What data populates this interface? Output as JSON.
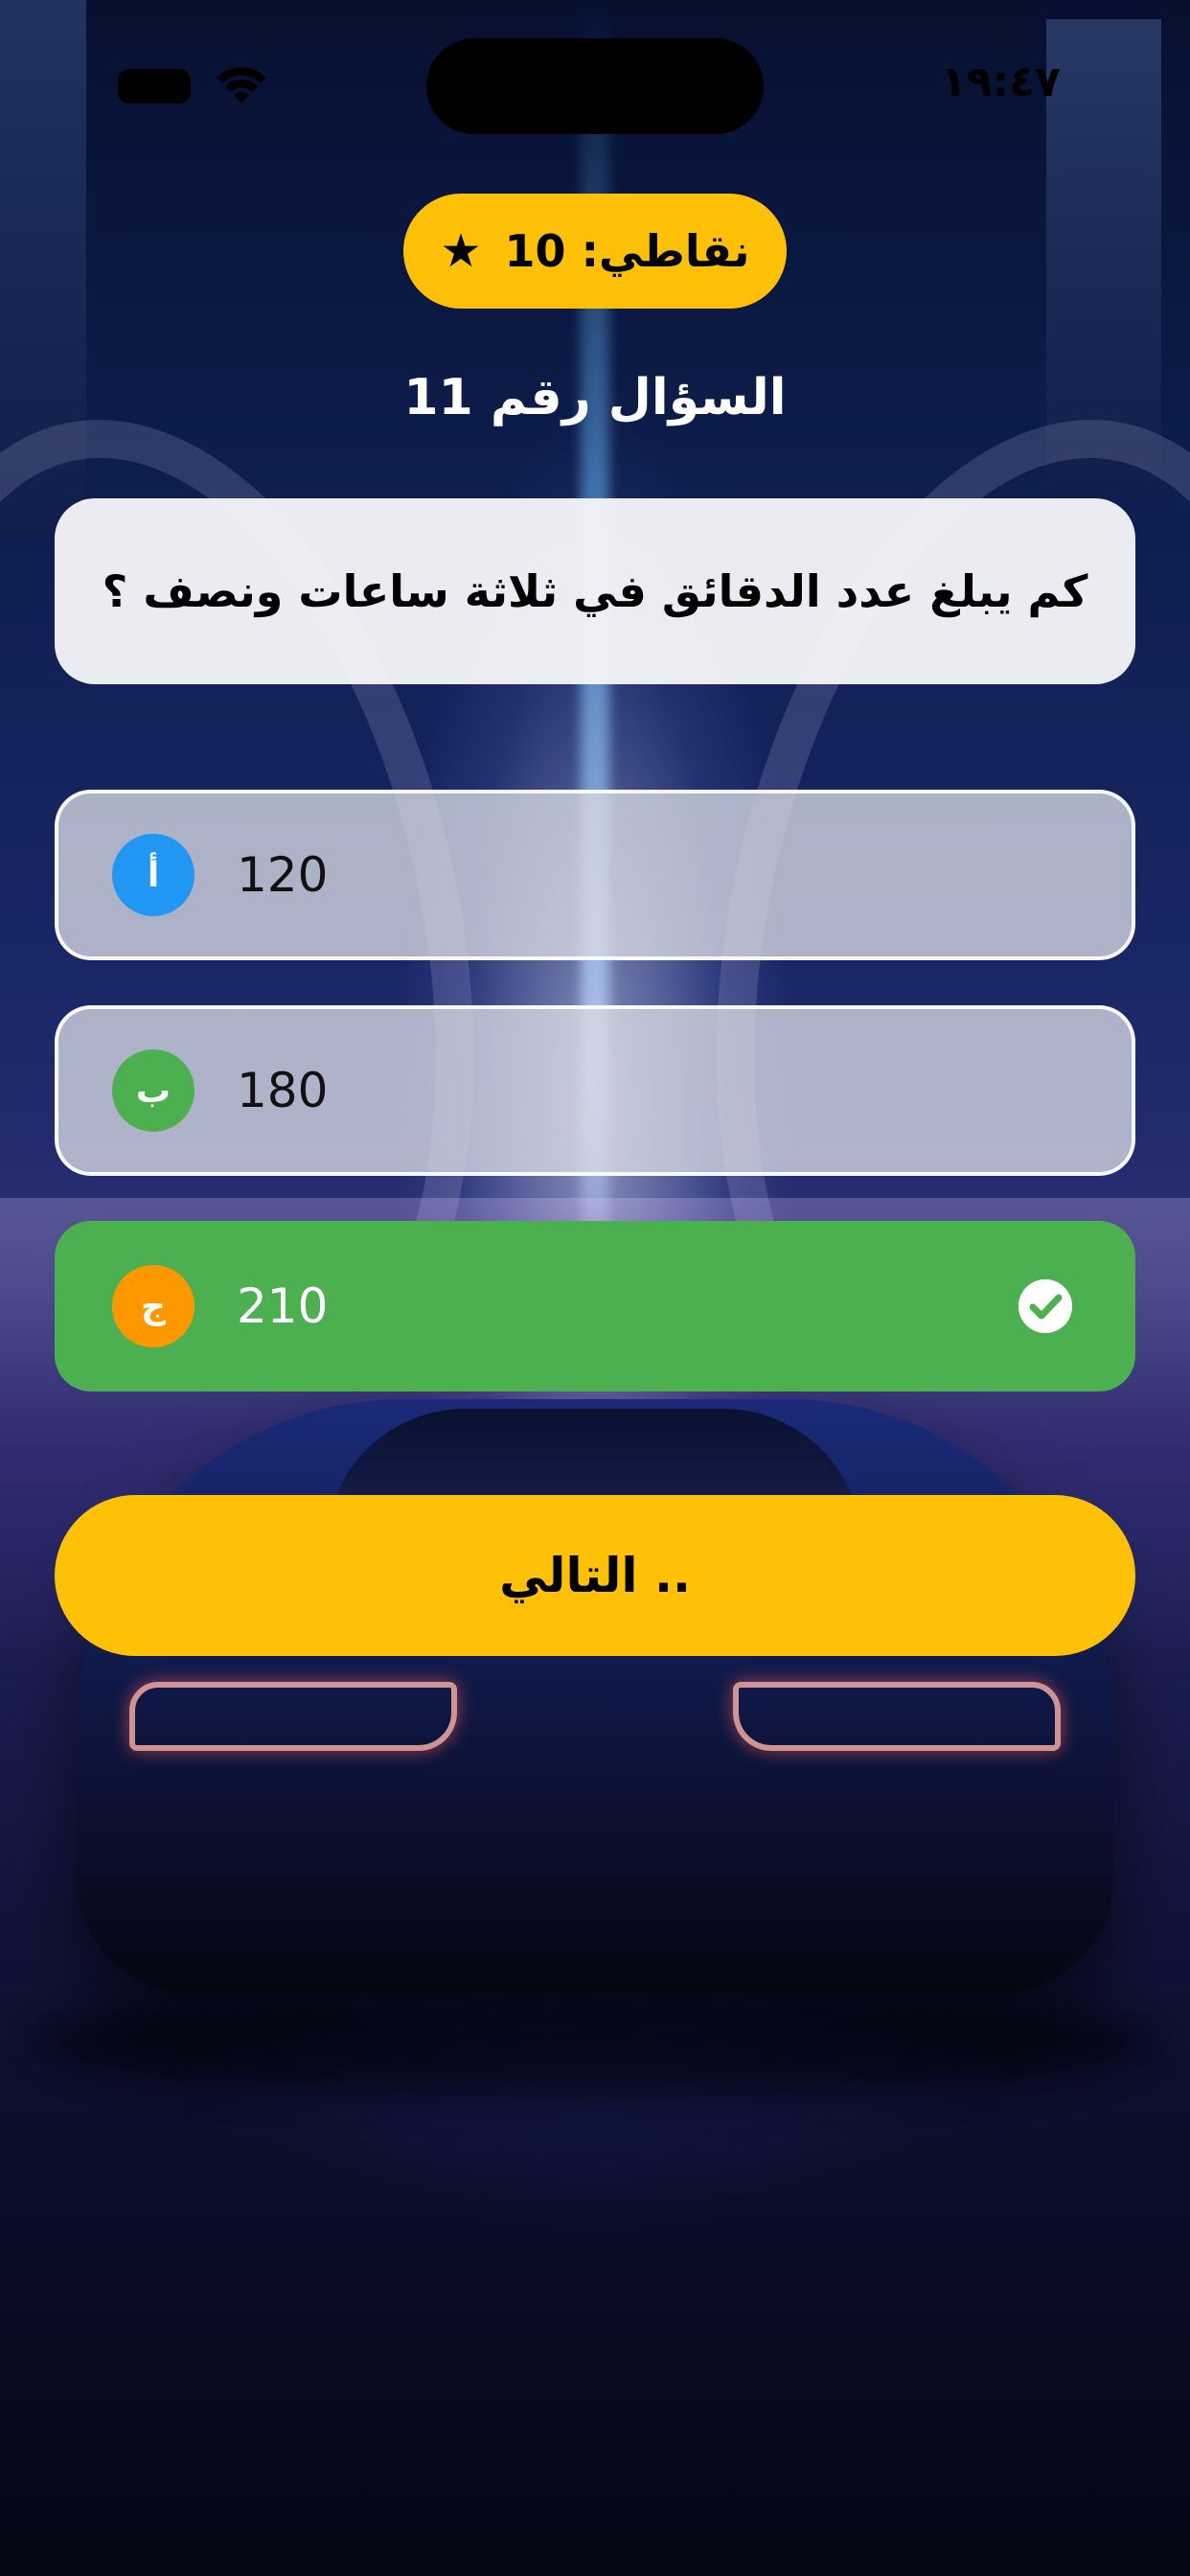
{
  "status_bar": {
    "time": "١٩:٤٧"
  },
  "score": {
    "label": "نقاطي: 10",
    "icon": "star-icon"
  },
  "question": {
    "number_label": "السؤال رقم 11",
    "text": "كم يبلغ عدد الدقائق في ثلاثة ساعات ونصف ؟"
  },
  "options": [
    {
      "letter": "أ",
      "value": "120",
      "badge_color": "#2196f3",
      "state": "neutral"
    },
    {
      "letter": "ب",
      "value": "180",
      "badge_color": "#4caf50",
      "state": "neutral"
    },
    {
      "letter": "ج",
      "value": "210",
      "badge_color": "#ff9800",
      "state": "correct"
    }
  ],
  "next_button": {
    "label": ".. التالي"
  },
  "colors": {
    "accent": "#ffc107",
    "correct": "#4caf50"
  }
}
